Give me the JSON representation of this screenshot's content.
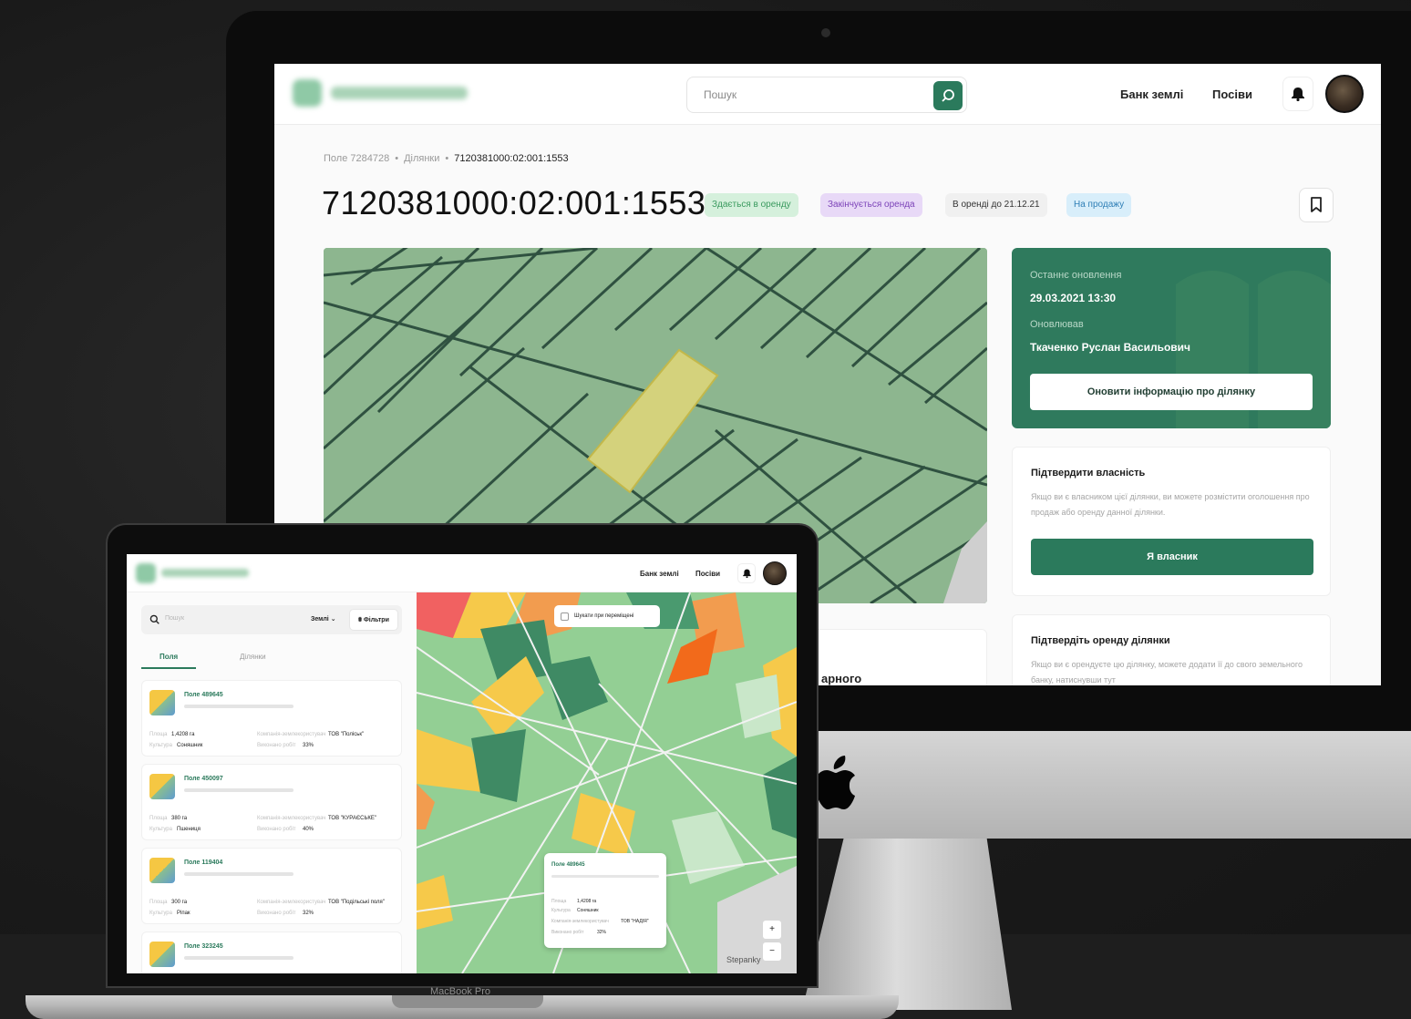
{
  "imac": {
    "search": {
      "placeholder": "Пошук"
    },
    "nav": {
      "land_bank": "Банк землі",
      "crops": "Посіви"
    },
    "breadcrumb": {
      "field": "Поле 7284728",
      "plots": "Ділянки",
      "current": "7120381000:02:001:1553"
    },
    "title": "7120381000:02:001:1553",
    "badges": [
      {
        "label": "Здається в оренду",
        "bg": "#d5f0dc",
        "fg": "#3a9a5e"
      },
      {
        "label": "Закінчується оренда",
        "bg": "#e8d9f7",
        "fg": "#7b42b8"
      },
      {
        "label": "В оренді до 21.12.21",
        "bg": "#f0f0f0",
        "fg": "#333333"
      },
      {
        "label": "На продажу",
        "bg": "#d8eefa",
        "fg": "#2f7fb6"
      }
    ],
    "update_card": {
      "last_update_label": "Останнє оновлення",
      "last_update_value": "29.03.2021 13:30",
      "updated_by_label": "Оновлював",
      "updated_by_value": "Ткаченко Руслан Васильович",
      "button": "Оновити інформацію про ділянку"
    },
    "ownership_card": {
      "title": "Підтвердити власність",
      "text": "Якщо ви є власником цієї ділянки, ви можете розмістити оголошення про продаж або оренду данної ділянки.",
      "button": "Я власник"
    },
    "lease_card": {
      "title": "Підтвердіть оренду ділянки",
      "text": "Якщо ви є орендуєте цю ділянку, можете додати її до свого земельного банку, натиснувши тут"
    },
    "partial_text": "арного"
  },
  "macbook": {
    "nav": {
      "land_bank": "Банк землі",
      "crops": "Посіви"
    },
    "search_placeholder": "Пошук",
    "dropdown": "Землі",
    "filters": "Фільтри",
    "tabs": [
      "Поля",
      "Ділянки"
    ],
    "fields": [
      {
        "name": "Поле 489645",
        "area": "1,4208 га",
        "crop": "Соняшник",
        "tenant": "ТОВ \"Поліськ\"",
        "share": "33%"
      },
      {
        "name": "Поле 450097",
        "area": "380 га",
        "crop": "Пшениця",
        "tenant": "ТОВ \"КУРАЄСЬКЕ\"",
        "share": "40%"
      },
      {
        "name": "Поле 119404",
        "area": "300 га",
        "crop": "Ріпак",
        "tenant": "ТОВ \"Подільські поля\"",
        "share": "32%"
      },
      {
        "name": "Поле 323245"
      }
    ],
    "field_labels": {
      "area": "Площа",
      "crop": "Культура",
      "tenant": "Компанія-землекористувач",
      "share": "Виконано робіт"
    },
    "map_pill": "Шукати при переміщені",
    "popup": {
      "name": "Поле 489645",
      "area": "1,4208 га",
      "crop": "Соняшник",
      "tenant": "ТОВ \"НАДІЯ\"",
      "share": "32%"
    },
    "zoom_in": "+",
    "zoom_out": "−",
    "city": "Stepanky",
    "device_label": "MacBook Pro"
  },
  "colors": {
    "accent": "#2b7a5c",
    "map_base": "#8db68f",
    "selected_plot": "#d4d27c"
  },
  "icons": [
    "search-icon",
    "bell-icon",
    "bookmark-icon",
    "filter-icon",
    "chevron-down-icon",
    "apple-logo-icon"
  ]
}
